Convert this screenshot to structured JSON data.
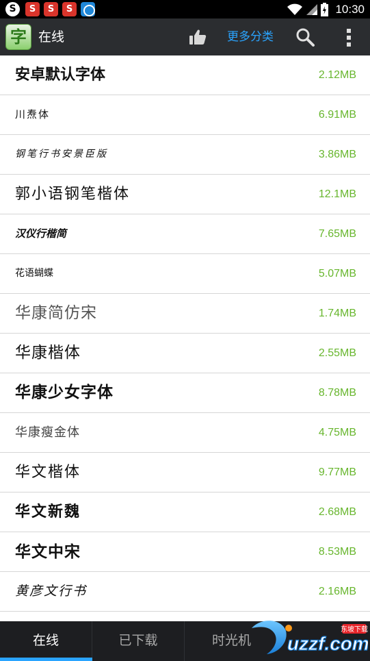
{
  "status_bar": {
    "time": "10:30",
    "notification_icons": [
      "sogou-icon",
      "red-s-icon",
      "red-s-icon",
      "red-s-icon",
      "blue-app-icon"
    ],
    "system_icons": [
      "wifi-icon",
      "signal-icon",
      "battery-icon"
    ]
  },
  "action_bar": {
    "logo_char": "字",
    "title": "在线",
    "more_label": "更多分类"
  },
  "fonts": [
    {
      "name": "安卓默认字体",
      "size": "2.12MB"
    },
    {
      "name": "川焘体",
      "size": "6.91MB"
    },
    {
      "name": "钢笔行书安景臣版",
      "size": "3.86MB"
    },
    {
      "name": "郭小语钢笔楷体",
      "size": "12.1MB"
    },
    {
      "name": "汉仪行楷简",
      "size": "7.65MB"
    },
    {
      "name": "花语蝴蝶",
      "size": "5.07MB"
    },
    {
      "name": "华康简仿宋",
      "size": "1.74MB"
    },
    {
      "name": "华康楷体",
      "size": "2.55MB"
    },
    {
      "name": "华康少女字体",
      "size": "8.78MB"
    },
    {
      "name": "华康瘦金体",
      "size": "4.75MB"
    },
    {
      "name": "华文楷体",
      "size": "9.77MB"
    },
    {
      "name": "华文新魏",
      "size": "2.68MB"
    },
    {
      "name": "华文中宋",
      "size": "8.53MB"
    },
    {
      "name": "黄彦文行书",
      "size": "2.16MB"
    }
  ],
  "tabs": [
    {
      "label": "在线",
      "active": true
    },
    {
      "label": "已下载",
      "active": false
    },
    {
      "label": "时光机",
      "active": false
    }
  ],
  "watermark": {
    "brand": "uzzf.com",
    "tag": "东坡下载"
  },
  "colors": {
    "accent": "#2aa4ff",
    "size_text": "#67b62d",
    "action_bar": "#2b2d30",
    "tab_bar": "#1d1e21"
  }
}
